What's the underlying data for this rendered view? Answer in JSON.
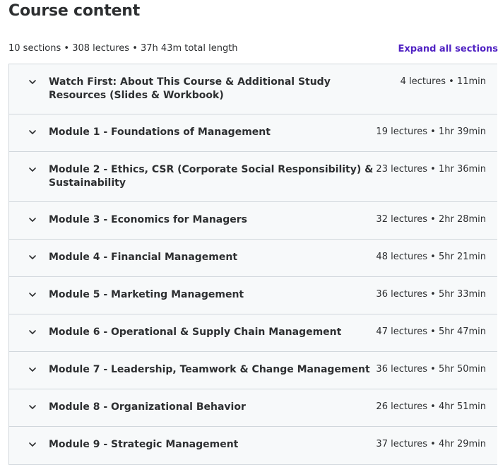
{
  "header": {
    "title": "Course content",
    "summary": "10 sections • 308 lectures • 37h 43m total length",
    "expand_label": "Expand all sections"
  },
  "sections": [
    {
      "title": "Watch First: About This Course & Additional Study Resources (Slides & Workbook)",
      "meta": "4 lectures • 11min"
    },
    {
      "title": "Module 1 - Foundations of Management",
      "meta": "19 lectures • 1hr 39min"
    },
    {
      "title": "Module 2 - Ethics, CSR (Corporate Social Responsibility) & Sustainability",
      "meta": "23 lectures • 1hr 36min"
    },
    {
      "title": "Module 3 - Economics for Managers",
      "meta": "32 lectures • 2hr 28min"
    },
    {
      "title": "Module 4 - Financial Management",
      "meta": "48 lectures • 5hr 21min"
    },
    {
      "title": "Module 5 - Marketing Management",
      "meta": "36 lectures • 5hr 33min"
    },
    {
      "title": "Module 6 - Operational & Supply Chain Management",
      "meta": "47 lectures • 5hr 47min"
    },
    {
      "title": "Module 7 - Leadership, Teamwork & Change Management",
      "meta": "36 lectures • 5hr 50min"
    },
    {
      "title": "Module 8 - Organizational Behavior",
      "meta": "26 lectures • 4hr 51min"
    },
    {
      "title": "Module 9 - Strategic Management",
      "meta": "37 lectures • 4hr 29min"
    }
  ],
  "icons": {
    "section_toggle": "chevron-down-icon"
  },
  "colors": {
    "accent": "#5022c3",
    "text": "#2d2f31",
    "row_background": "#f7f9fa",
    "border": "#d1d7dc"
  }
}
